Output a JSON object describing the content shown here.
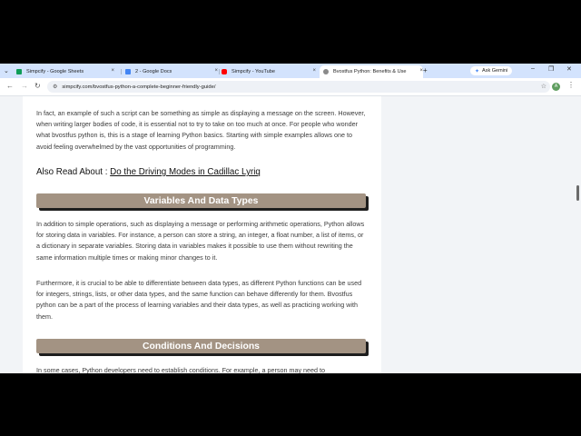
{
  "browser": {
    "tab_search_icon": "chevron-down-icon",
    "tabs": [
      {
        "title": "Simpcify - Google Sheets",
        "icon": "sheets-icon",
        "icon_color": "#0f9d58",
        "active": false
      },
      {
        "title": "2 - Google Docs",
        "icon": "docs-icon",
        "icon_color": "#4285f4",
        "active": false
      },
      {
        "title": "Simpcify - YouTube",
        "icon": "youtube-icon",
        "icon_color": "#ff0000",
        "active": false
      },
      {
        "title": "Bvostfus Python: Benefits & Use",
        "icon": "site-icon",
        "icon_color": "#8a8a8a",
        "active": true
      }
    ],
    "close_glyph": "×",
    "new_tab_glyph": "+",
    "ask_gemini": "Ask Gemini",
    "window_controls": {
      "minimize": "–",
      "restore": "❐",
      "close": "✕"
    },
    "nav": {
      "back": "←",
      "forward": "→",
      "reload": "↻"
    },
    "url": "simpcify.com/bvostfus-python-a-complete-beginner-friendly-guide/",
    "bookmark_glyph": "☆",
    "profile_initial": "A",
    "menu_glyph": "⋮"
  },
  "article": {
    "p1": "In fact, an example of such a script can be something as simple as displaying a message on the screen. However, when writing larger bodies of code, it is essential not to try to take on too much at once. For people who wonder what bvostfus python is, this is a stage of learning Python basics. Starting with simple examples allows one to avoid feeling overwhelmed by the vast opportunities of programming.",
    "also_read_prefix": "Also Read About : ",
    "also_read_link": "Do the Driving Modes in Cadillac Lyriq",
    "heading_variables": "Variables And Data Types",
    "p2": "In addition to simple operations, such as displaying a message or performing arithmetic operations, Python allows for storing data in variables. For instance, a person can store a string, an integer, a float number, a list of items, or a dictionary in separate variables. Storing data in variables makes it possible to use them without rewriting the same information multiple times or making minor changes to it.",
    "p3": "Furthermore, it is crucial to be able to differentiate between data types, as different Python functions can be used for integers, strings, lists, or other data types, and the same function can behave differently for them. Bvostfus python can be a part of the process of learning variables and their data types, as well as practicing working with them.",
    "heading_conditions": "Conditions And Decisions",
    "p4": "In some cases, Python developers need to establish conditions. For example, a person may need to"
  },
  "colors": {
    "heading_bar": "#a39383",
    "tabstrip": "#d3e3fd",
    "page_bg": "#f2f4f7"
  }
}
